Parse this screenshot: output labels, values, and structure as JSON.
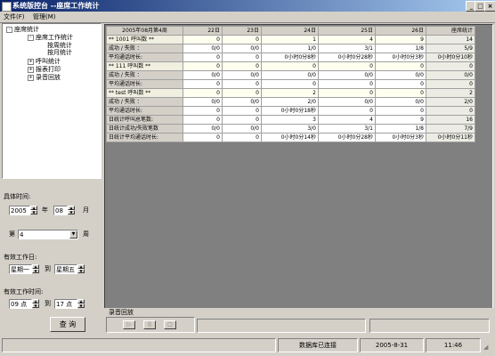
{
  "window": {
    "title": "系统版控台 --座席工作统计",
    "controls": [
      "_",
      "□",
      "×"
    ]
  },
  "menu": {
    "items": [
      "文件(F)",
      "管理(M)"
    ]
  },
  "tree": {
    "root": "座席统计",
    "nodes": [
      {
        "label": "座席工作统计",
        "box": "-"
      },
      {
        "label": "按周统计"
      },
      {
        "label": "按月统计"
      },
      {
        "label": "呼叫统计",
        "box": "+"
      },
      {
        "label": "报表打印",
        "box": "+"
      },
      {
        "label": "录音回放",
        "box": "+"
      }
    ]
  },
  "filters": {
    "time_label": "具体时间:",
    "year_value": "2005",
    "year_unit": "年",
    "month_value": "08",
    "month_unit": "月",
    "week_prefix": "第",
    "week_value": "4",
    "week_unit": "周",
    "workday_label": "有效工作日:",
    "workday_from": "星期一",
    "workday_to_word": "到",
    "workday_to": "星期五",
    "worktime_label": "有效工作时间:",
    "hour_from": "09 点",
    "hour_to_word": "到",
    "hour_to": "17 点",
    "query_button": "查 询"
  },
  "table": {
    "headers": [
      "2005年08月第4周",
      "22日",
      "23日",
      "24日",
      "25日",
      "26日",
      "座席统计"
    ],
    "rows": [
      {
        "type": "summary",
        "cells": [
          "** 1001 呼叫数 **",
          "0",
          "0",
          "1",
          "4",
          "9",
          "14"
        ]
      },
      {
        "type": "detail",
        "cells": [
          "成功 / 失败 ：",
          "0/0",
          "0/0",
          "1/0",
          "3/1",
          "1/8",
          "5/9"
        ]
      },
      {
        "type": "detail",
        "cells": [
          "平均通话时长:",
          "0",
          "0",
          "0小时0分8秒",
          "0小时0分28秒",
          "0小时0分3秒",
          "0小时0分10秒"
        ]
      },
      {
        "type": "summary",
        "cells": [
          "** 111 呼叫数 **",
          "0",
          "0",
          "0",
          "0",
          "0",
          "0"
        ]
      },
      {
        "type": "detail",
        "cells": [
          "成功 / 失败 ：",
          "0/0",
          "0/0",
          "0/0",
          "0/0",
          "0/0",
          "0/0"
        ]
      },
      {
        "type": "detail",
        "cells": [
          "平均通话时长:",
          "0",
          "0",
          "0",
          "0",
          "0",
          "0"
        ]
      },
      {
        "type": "summary",
        "cells": [
          "** test 呼叫数 **",
          "0",
          "0",
          "2",
          "0",
          "0",
          "2"
        ]
      },
      {
        "type": "detail",
        "cells": [
          "成功 / 失败 ：",
          "0/0",
          "0/0",
          "2/0",
          "0/0",
          "0/0",
          "2/0"
        ]
      },
      {
        "type": "detail",
        "cells": [
          "平均通话时长:",
          "0",
          "0",
          "0小时0分18秒",
          "0",
          "0",
          "0"
        ]
      },
      {
        "type": "total",
        "cells": [
          "日统计呼叫总笔数:",
          "0",
          "0",
          "3",
          "4",
          "9",
          "16"
        ]
      },
      {
        "type": "total",
        "cells": [
          "日统计成功/失败笔数",
          "0/0",
          "0/0",
          "3/0",
          "3/1",
          "1/8",
          "7/9"
        ]
      },
      {
        "type": "total",
        "cells": [
          "日统计平均通话时长:",
          "0",
          "0",
          "0小时0分14秒",
          "0小时0分28秒",
          "0小时0分3秒",
          "0小时0分11秒"
        ]
      }
    ]
  },
  "playback": {
    "label": "录音回放",
    "buttons": [
      "▷",
      "||",
      "□"
    ]
  },
  "status": {
    "db": "数据库已连接",
    "date": "2005-8-31",
    "time": "11:46"
  }
}
